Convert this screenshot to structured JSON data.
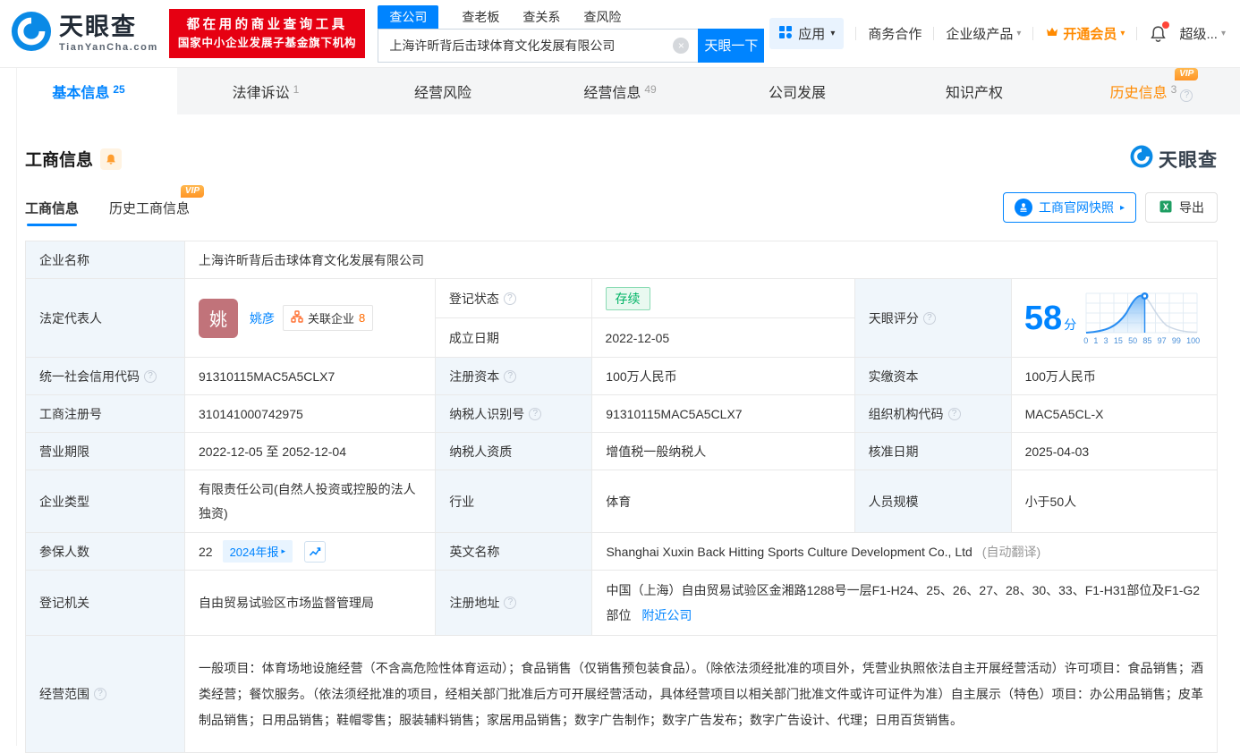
{
  "icons": {
    "caret_down": "▾",
    "caret_right": "▸",
    "clear": "×",
    "help": "?"
  },
  "colors": {
    "brand_blue": "#0084ff",
    "vip_orange": "#ff8a00",
    "status_green": "#00b365",
    "banner_red": "#e60012",
    "score_blue": "#0084ff"
  },
  "header": {
    "logo": {
      "title": "天眼查",
      "domain": "TianYanCha.com"
    },
    "banner": {
      "line1": "都在用的商业查询工具",
      "line2": "国家中小企业发展子基金旗下机构"
    },
    "search": {
      "tabs": [
        {
          "label": "查公司",
          "active": true
        },
        {
          "label": "查老板",
          "active": false
        },
        {
          "label": "查关系",
          "active": false
        },
        {
          "label": "查风险",
          "active": false
        }
      ],
      "value": "上海许昕背后击球体育文化发展有限公司",
      "button": "天眼一下"
    },
    "nav": {
      "apps": "应用",
      "cooperation": "商务合作",
      "enterprise": "企业级产品",
      "vip": "开通会员",
      "super": "超级..."
    }
  },
  "main_tabs": [
    {
      "label": "基本信息",
      "count": "25",
      "active": true
    },
    {
      "label": "法律诉讼",
      "count": "1"
    },
    {
      "label": "经营风险",
      "count": ""
    },
    {
      "label": "经营信息",
      "count": "49"
    },
    {
      "label": "公司发展",
      "count": ""
    },
    {
      "label": "知识产权",
      "count": ""
    },
    {
      "label": "历史信息",
      "count": "3",
      "vip": "VIP"
    }
  ],
  "section": {
    "title": "工商信息",
    "watermark": "天眼查",
    "subtab_current": "工商信息",
    "subtab_history": "历史工商信息",
    "vip_badge": "VIP",
    "snapshot_button": "工商官网快照",
    "export_button": "导出"
  },
  "table": {
    "company_name": {
      "label": "企业名称",
      "value": "上海许昕背后击球体育文化发展有限公司"
    },
    "legal_rep": {
      "label": "法定代表人",
      "avatar": "姚",
      "name": "姚彦",
      "related_label": "关联企业",
      "related_count": "8"
    },
    "reg_status": {
      "label": "登记状态",
      "value": "存续"
    },
    "establish_date": {
      "label": "成立日期",
      "value": "2022-12-05"
    },
    "score": {
      "label": "天眼评分",
      "value": "58",
      "unit": "分",
      "axis": [
        "0",
        "1",
        "3",
        "15",
        "50",
        "85",
        "97",
        "99",
        "100"
      ]
    },
    "credit_code": {
      "label": "统一社会信用代码",
      "value": "91310115MAC5A5CLX7"
    },
    "reg_capital": {
      "label": "注册资本",
      "value": "100万人民币"
    },
    "paid_capital": {
      "label": "实缴资本",
      "value": "100万人民币"
    },
    "reg_number": {
      "label": "工商注册号",
      "value": "310141000742975"
    },
    "taxpayer_id": {
      "label": "纳税人识别号",
      "value": "91310115MAC5A5CLX7"
    },
    "org_code": {
      "label": "组织机构代码",
      "value": "MAC5A5CL-X"
    },
    "business_term": {
      "label": "营业期限",
      "value": "2022-12-05 至 2052-12-04"
    },
    "taxpayer_quality": {
      "label": "纳税人资质",
      "value": "增值税一般纳税人"
    },
    "approval_date": {
      "label": "核准日期",
      "value": "2025-04-03"
    },
    "company_type": {
      "label": "企业类型",
      "value": "有限责任公司(自然人投资或控股的法人独资)"
    },
    "industry": {
      "label": "行业",
      "value": "体育"
    },
    "staff_size": {
      "label": "人员规模",
      "value": "小于50人"
    },
    "insured": {
      "label": "参保人数",
      "value": "22",
      "report_chip": "2024年报"
    },
    "english_name": {
      "label": "英文名称",
      "value": "Shanghai Xuxin Back Hitting Sports Culture Development Co., Ltd",
      "note": "(自动翻译)"
    },
    "reg_authority": {
      "label": "登记机关",
      "value": "自由贸易试验区市场监督管理局"
    },
    "reg_address": {
      "label": "注册地址",
      "value": "中国（上海）自由贸易试验区金湘路1288号一层F1-H24、25、26、27、28、30、33、F1-H31部位及F1-G2部位",
      "link": "附近公司"
    },
    "business_scope": {
      "label": "经营范围",
      "value": "一般项目：体育场地设施经营（不含高危险性体育运动）；食品销售（仅销售预包装食品）。（除依法须经批准的项目外，凭营业执照依法自主开展经营活动）许可项目：食品销售；酒类经营；餐饮服务。（依法须经批准的项目，经相关部门批准后方可开展经营活动，具体经营项目以相关部门批准文件或许可证件为准）自主展示（特色）项目：办公用品销售；皮革制品销售；日用品销售；鞋帽零售；服装辅料销售；家居用品销售；数字广告制作；数字广告发布；数字广告设计、代理；日用百货销售。"
    }
  }
}
